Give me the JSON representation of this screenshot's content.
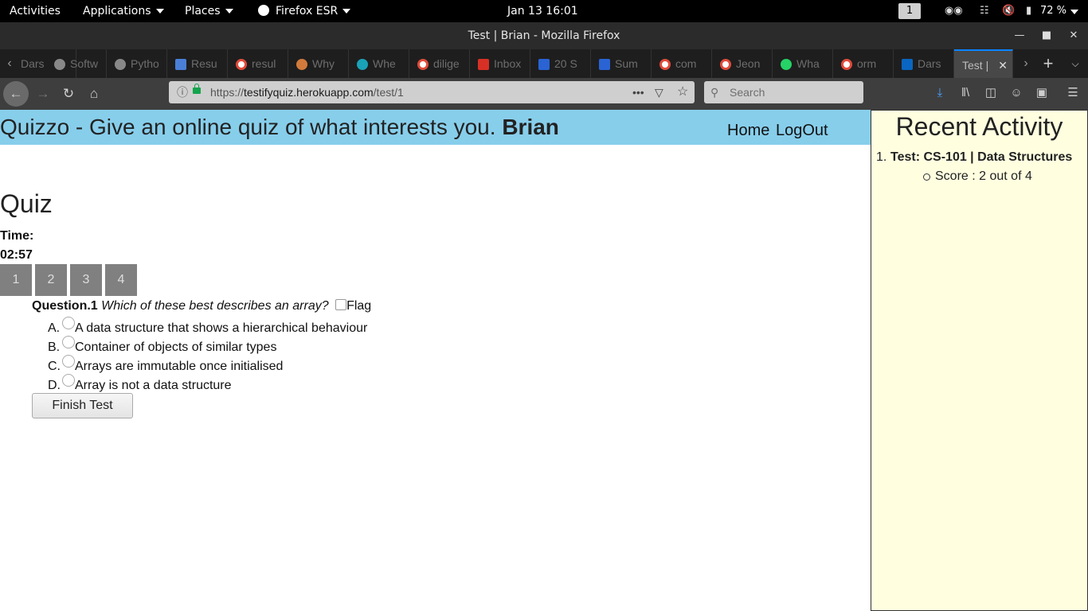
{
  "system_bar": {
    "activities": "Activities",
    "applications": "Applications",
    "places": "Places",
    "app_name": "Firefox ESR",
    "datetime": "Jan 13  16:01",
    "workspace": "1",
    "battery": "72 %"
  },
  "window": {
    "title": "Test | Brian - Mozilla Firefox"
  },
  "tabs": [
    {
      "label": "Dars"
    },
    {
      "label": "Softw"
    },
    {
      "label": "Pytho"
    },
    {
      "label": "Resu"
    },
    {
      "label": "resul"
    },
    {
      "label": "Why"
    },
    {
      "label": "Whe"
    },
    {
      "label": "dilige"
    },
    {
      "label": "Inbox"
    },
    {
      "label": "20 S"
    },
    {
      "label": "Sum"
    },
    {
      "label": "com"
    },
    {
      "label": "Jeon"
    },
    {
      "label": "Wha"
    },
    {
      "label": "orm"
    },
    {
      "label": "Dars"
    },
    {
      "label": "Test |"
    }
  ],
  "navbar": {
    "url_prefix": "https://",
    "url_domain": "testifyquiz.herokuapp.com",
    "url_path": "/test/1",
    "search_placeholder": "Search"
  },
  "header": {
    "brand_text": "Quizzo - Give an online quiz of what interests you.",
    "username": "Brian",
    "home_link": "Home",
    "logout_link": "LogOut"
  },
  "quiz": {
    "title": "Quiz",
    "time_label": "Time:",
    "time_value": "02:57",
    "question_nav": [
      "1",
      "2",
      "3",
      "4"
    ],
    "question_label": "Question.1",
    "question_text": "Which of these best describes an array?",
    "flag_label": "Flag",
    "options": [
      {
        "letter": "A.",
        "text": "A data structure that shows a hierarchical behaviour"
      },
      {
        "letter": "B.",
        "text": "Container of objects of similar types"
      },
      {
        "letter": "C.",
        "text": "Arrays are immutable once initialised"
      },
      {
        "letter": "D.",
        "text": "Array is not a data structure"
      }
    ],
    "finish_button": "Finish Test"
  },
  "sidebar": {
    "title": "Recent Activity",
    "items": [
      {
        "number": "1.",
        "title": "Test: CS-101 | Data Structures",
        "score": "Score : 2 out of 4"
      }
    ]
  }
}
